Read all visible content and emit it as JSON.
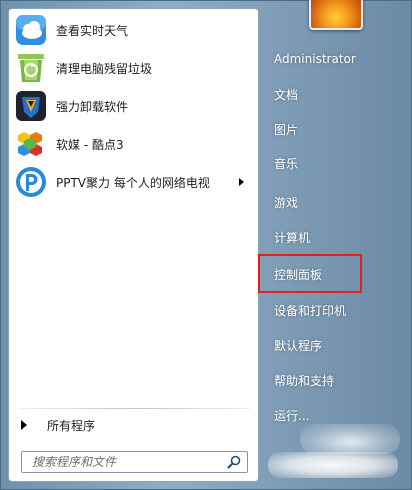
{
  "programs": [
    {
      "label": "查看实时天气",
      "icon": "weather-icon"
    },
    {
      "label": "清理电脑残留垃圾",
      "icon": "recycle-bin-icon"
    },
    {
      "label": "强力卸载软件",
      "icon": "uninstall-icon"
    },
    {
      "label": "软媒 - 酷点3",
      "icon": "cubes-icon"
    },
    {
      "label": "PPTV聚力 每个人的网络电视",
      "icon": "pptv-icon",
      "has_submenu": true
    }
  ],
  "all_programs": {
    "label": "所有程序"
  },
  "search": {
    "placeholder": "搜索程序和文件"
  },
  "right_menu": [
    {
      "label": "Administrator"
    },
    {
      "label": "文档"
    },
    {
      "label": "图片"
    },
    {
      "label": "音乐"
    },
    {
      "label": "游戏"
    },
    {
      "label": "计算机"
    },
    {
      "label": "控制面板",
      "highlighted": true
    },
    {
      "label": "设备和打印机"
    },
    {
      "label": "默认程序"
    },
    {
      "label": "帮助和支持"
    },
    {
      "label": "运行..."
    }
  ],
  "colors": {
    "highlight_border": "#e2211b",
    "frame": "#7a99b4"
  }
}
